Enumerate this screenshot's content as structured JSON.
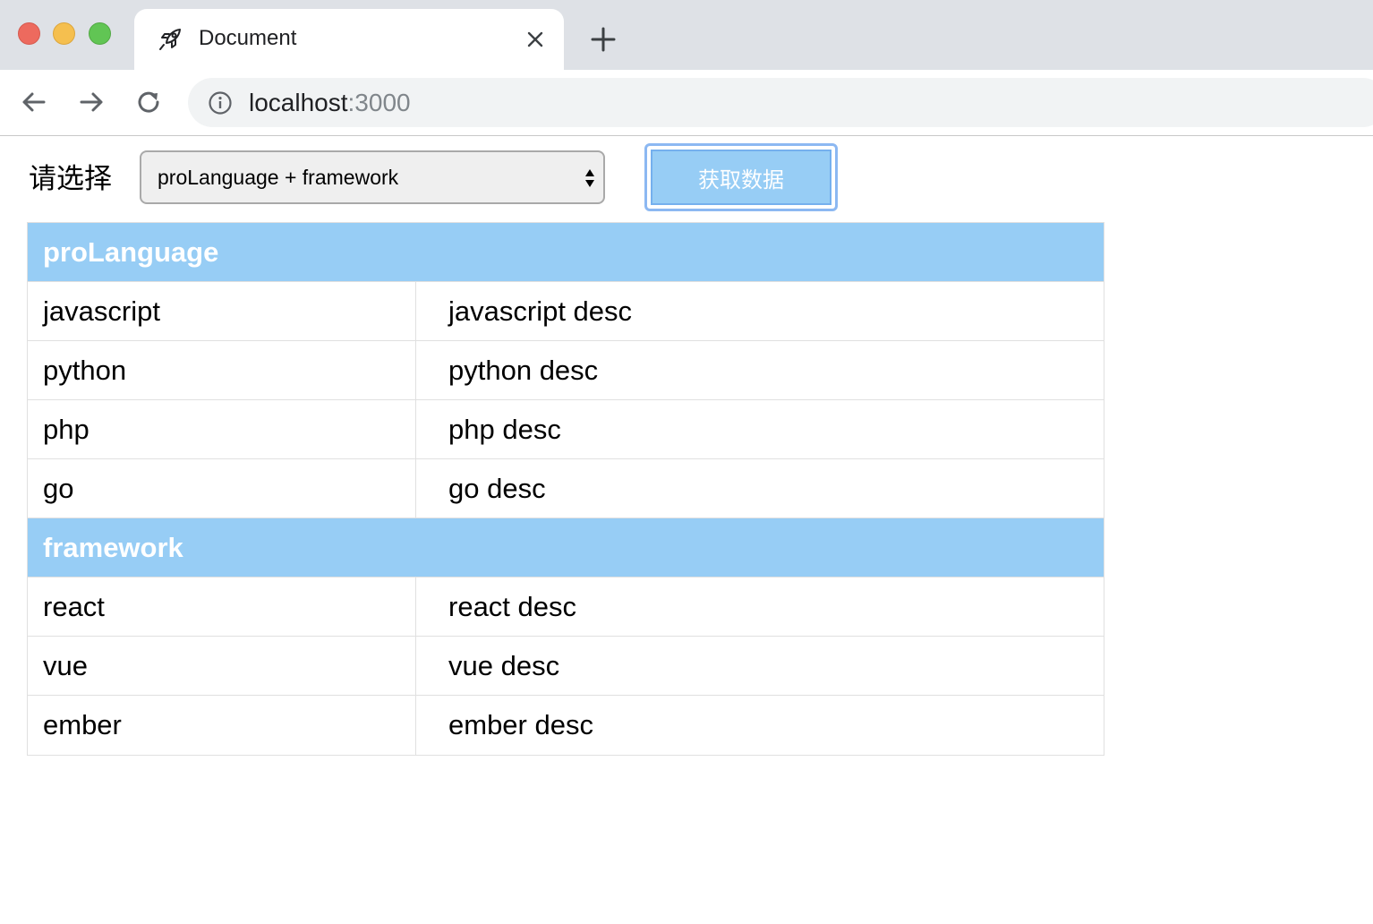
{
  "browser": {
    "tab_title": "Document",
    "url_host": "localhost",
    "url_port": ":3000"
  },
  "controls": {
    "select_label": "请选择",
    "select_value": "proLanguage + framework",
    "fetch_button_label": "获取数据"
  },
  "table": {
    "groups": [
      {
        "title": "proLanguage",
        "rows": [
          {
            "name": "javascript",
            "desc": "javascript desc"
          },
          {
            "name": "python",
            "desc": "python desc"
          },
          {
            "name": "php",
            "desc": "php desc"
          },
          {
            "name": "go",
            "desc": "go desc"
          }
        ]
      },
      {
        "title": "framework",
        "rows": [
          {
            "name": "react",
            "desc": "react desc"
          },
          {
            "name": "vue",
            "desc": "vue desc"
          },
          {
            "name": "ember",
            "desc": "ember desc"
          }
        ]
      }
    ]
  },
  "colors": {
    "header_blue": "#97cdf5",
    "button_focus_ring": "#8cb8f2"
  },
  "icons": {
    "tab": "rocket-icon",
    "close": "close-icon",
    "new_tab": "plus-icon",
    "back": "arrow-left-icon",
    "forward": "arrow-right-icon",
    "reload": "reload-icon",
    "site_info": "info-icon",
    "select": "select-arrows-icon"
  }
}
